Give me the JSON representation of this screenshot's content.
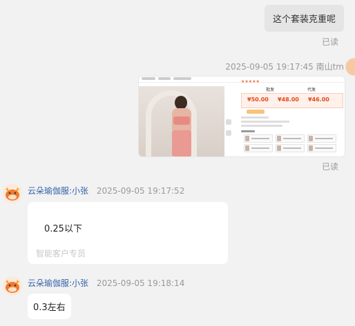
{
  "messages": {
    "out_text": "这个套装克重呢",
    "read_1": "已读",
    "out_image_meta": "2025-09-05 19:17:45   南山tm",
    "read_2": "已读",
    "agent_msg_1": {
      "sender": "云朵瑜伽服:小张",
      "time": "2025-09-05 19:17:52",
      "text": "0.25以下",
      "signature": "智能客户专员"
    },
    "agent_msg_2": {
      "sender": "云朵瑜伽服:小张",
      "time": "2025-09-05 19:18:14",
      "text": "0.3左右"
    }
  },
  "product_image": {
    "prices": [
      "¥50.00",
      "¥48.00",
      "¥46.00"
    ],
    "tabs": [
      "批发",
      "代发"
    ]
  },
  "colors": {
    "background": "#f2f2f2",
    "agent_name": "#3461a8",
    "price_red": "#e24b21"
  },
  "icons": [
    "avatar-cow-icon"
  ]
}
